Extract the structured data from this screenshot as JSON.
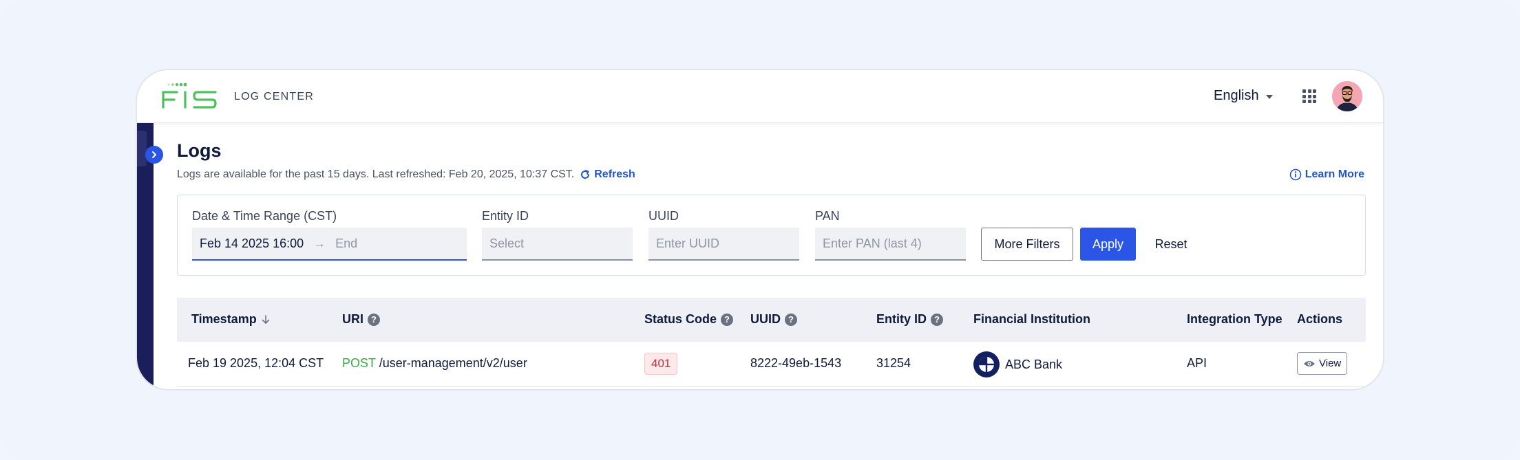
{
  "app": {
    "brand": "FIS",
    "title": "LOG CENTER"
  },
  "header": {
    "language": "English"
  },
  "page": {
    "title": "Logs",
    "subtitle": "Logs are available for the past 15 days. Last refreshed: Feb 20, 2025, 10:37 CST.",
    "refresh_label": "Refresh",
    "learn_more_label": "Learn More"
  },
  "filters": {
    "date_label": "Date & Time Range (CST)",
    "date_start": "Feb 14 2025 16:00",
    "date_end_placeholder": "End",
    "entity_label": "Entity ID",
    "entity_placeholder": "Select",
    "uuid_label": "UUID",
    "uuid_placeholder": "Enter UUID",
    "pan_label": "PAN",
    "pan_placeholder": "Enter PAN (last 4)",
    "more_filters_label": "More Filters",
    "apply_label": "Apply",
    "reset_label": "Reset"
  },
  "table": {
    "columns": [
      "Timestamp",
      "URI",
      "Status Code",
      "UUID",
      "Entity ID",
      "Financial Institution",
      "Integration Type",
      "Actions"
    ],
    "rows": [
      {
        "timestamp": "Feb 19 2025, 12:04 CST",
        "method": "POST",
        "uri": "/user-management/v2/user",
        "status": "401",
        "uuid": "8222-49eb-1543",
        "entity_id": "31254",
        "institution": "ABC Bank",
        "integration": "API",
        "action": "View"
      }
    ]
  },
  "colors": {
    "accent": "#2b55e6",
    "sidebar": "#1a1f5c",
    "brand_green": "#4cc35a",
    "error": "#c0303f"
  }
}
